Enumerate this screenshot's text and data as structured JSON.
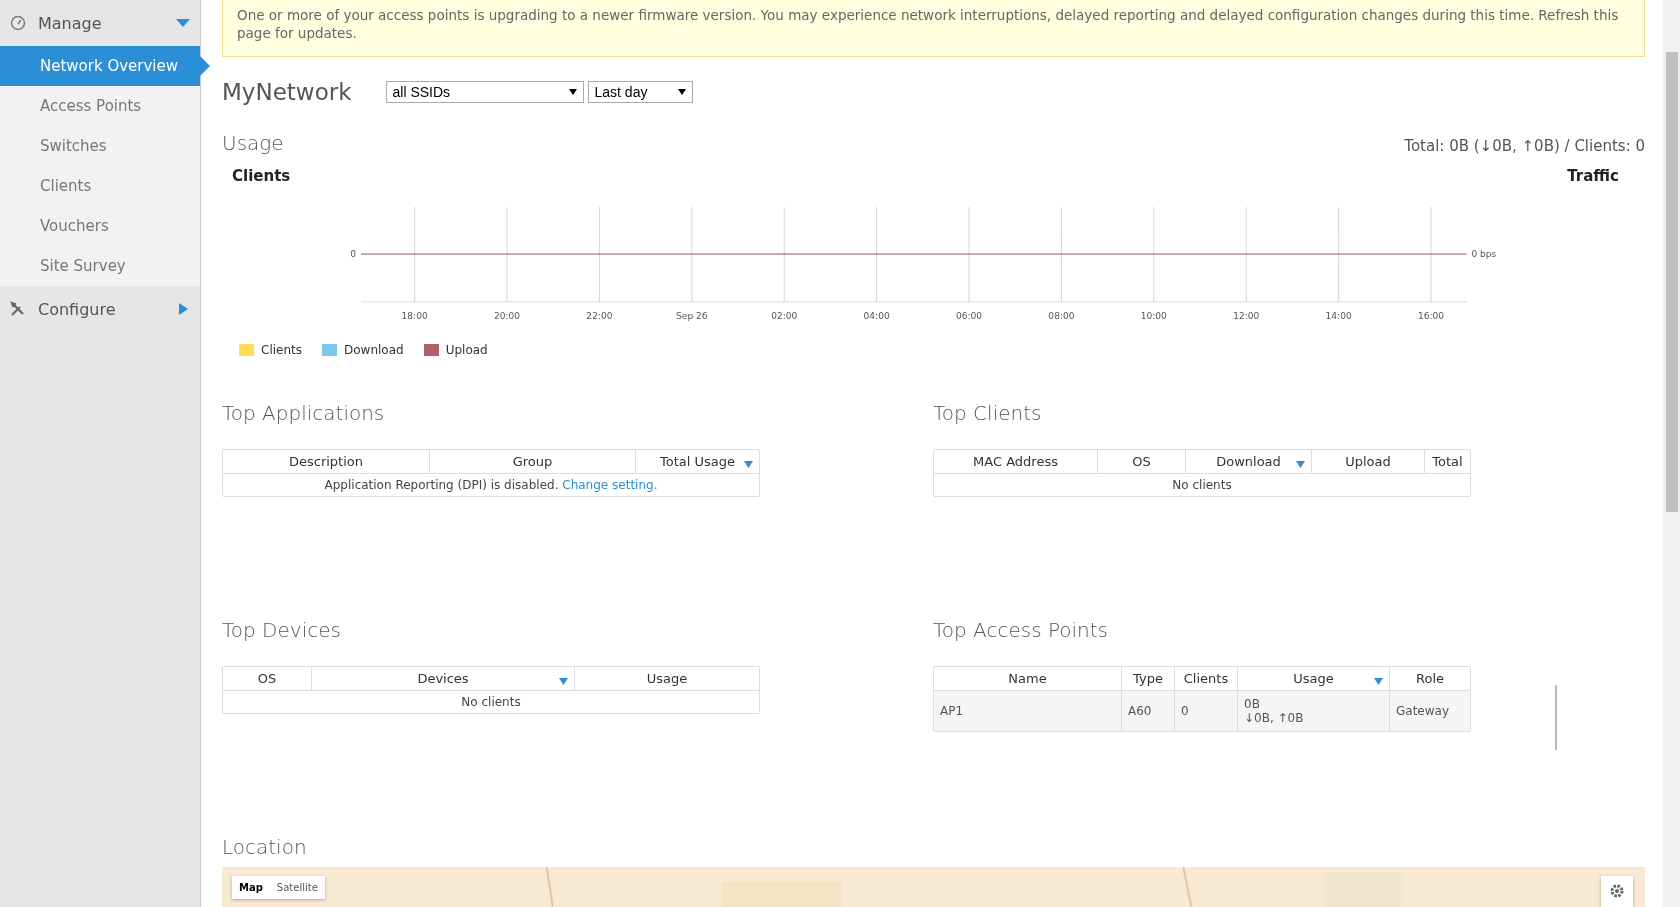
{
  "sidebar": {
    "groups": [
      {
        "label": "Manage",
        "expanded": true,
        "items": [
          {
            "label": "Network Overview",
            "selected": true
          },
          {
            "label": "Access Points",
            "selected": false
          },
          {
            "label": "Switches",
            "selected": false
          },
          {
            "label": "Clients",
            "selected": false
          },
          {
            "label": "Vouchers",
            "selected": false
          },
          {
            "label": "Site Survey",
            "selected": false
          }
        ]
      },
      {
        "label": "Configure",
        "expanded": false
      }
    ]
  },
  "banner": {
    "text": "One or more of your access points is upgrading to a newer firmware version. You may experience network interruptions, delayed reporting and delayed configuration changes during this time. Refresh this page for updates."
  },
  "network": {
    "title": "MyNetwork",
    "filters": [
      {
        "value": "all SSIDs"
      },
      {
        "value": "Last day"
      }
    ]
  },
  "usage": {
    "title": "Usage",
    "summary": "Total: 0B (↓0B, ↑0B) / Clients: 0",
    "left_title": "Clients",
    "right_title": "Traffic",
    "left_tick": "0",
    "right_tick": "0 bps",
    "x_labels": [
      "18:00",
      "20:00",
      "22:00",
      "Sep 26",
      "02:00",
      "04:00",
      "06:00",
      "08:00",
      "10:00",
      "12:00",
      "14:00",
      "16:00"
    ],
    "legend": [
      {
        "label": "Clients",
        "color": "#ffdd55"
      },
      {
        "label": "Download",
        "color": "#7ec8ec"
      },
      {
        "label": "Upload",
        "color": "#b0606a"
      }
    ]
  },
  "sections": [
    {
      "title": "Top Applications",
      "columns": [
        {
          "label": "Description",
          "sorted": false
        },
        {
          "label": "Group",
          "sorted": false
        },
        {
          "label": "Total Usage",
          "sorted": true
        }
      ],
      "empty": {
        "text": "Application Reporting (DPI) is disabled.",
        "link": "Change setting."
      }
    },
    {
      "title": "Top Clients",
      "columns": [
        {
          "label": "MAC Address",
          "sorted": false
        },
        {
          "label": "OS",
          "sorted": false
        },
        {
          "label": "Download",
          "sorted": true
        },
        {
          "label": "Upload",
          "sorted": false
        },
        {
          "label": "Total",
          "sorted": false
        }
      ],
      "empty": {
        "text": "No clients"
      }
    },
    {
      "title": "Top Devices",
      "columns": [
        {
          "label": "OS",
          "sorted": false
        },
        {
          "label": "Devices",
          "sorted": true
        },
        {
          "label": "Usage",
          "sorted": false
        }
      ],
      "empty": {
        "text": "No clients"
      }
    },
    {
      "title": "Top Access Points",
      "columns": [
        {
          "label": "Name",
          "sorted": false
        },
        {
          "label": "Type",
          "sorted": false
        },
        {
          "label": "Clients",
          "sorted": false
        },
        {
          "label": "Usage",
          "sorted": true
        },
        {
          "label": "Role",
          "sorted": false
        }
      ],
      "rows": [
        {
          "cells": [
            [
              "AP1"
            ],
            [
              "A60"
            ],
            [
              "0"
            ],
            [
              "0B",
              "↓0B, ↑0B"
            ],
            [
              "Gateway"
            ]
          ]
        }
      ]
    }
  ],
  "location": {
    "title": "Location",
    "map_types": [
      {
        "label": "Map",
        "selected": true
      },
      {
        "label": "Satellite",
        "selected": false
      }
    ]
  }
}
